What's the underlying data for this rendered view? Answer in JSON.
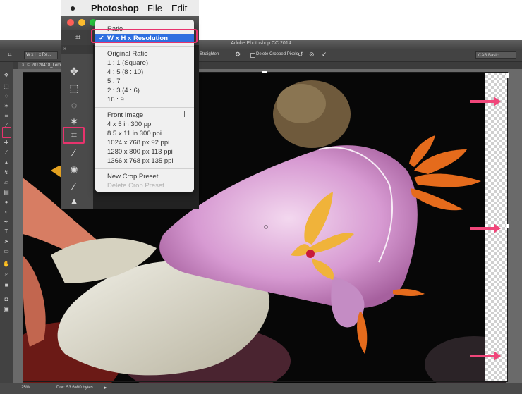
{
  "mac_menubar": {
    "apple_icon": "apple-logo",
    "app_name": "Photoshop",
    "menu_file": "File",
    "menu_edit": "Edit"
  },
  "window": {
    "title": "Adobe Photoshop CC 2014",
    "traffic_lights": [
      "#ff5f57",
      "#febc2e",
      "#28c840"
    ]
  },
  "options_bar": {
    "ratio_select": "W x H x Re...",
    "straighten_label": "Straighten",
    "delete_cropped_label": "Delete Cropped Pixels",
    "workspace_select": "CAB Basic"
  },
  "document_tab": {
    "label": "© 20120418_Lem"
  },
  "crop_ratio_menu": {
    "items": [
      {
        "label": "Ratio",
        "state": "normal"
      },
      {
        "label": "W x H x Resolution",
        "state": "selected"
      },
      {
        "label": "Original Ratio",
        "state": "normal"
      },
      {
        "label": "1 : 1 (Square)",
        "state": "normal"
      },
      {
        "label": "4 : 5 (8 : 10)",
        "state": "normal"
      },
      {
        "label": "5 : 7",
        "state": "normal"
      },
      {
        "label": "2 : 3 (4 : 6)",
        "state": "normal"
      },
      {
        "label": "16 : 9",
        "state": "normal"
      },
      {
        "label": "Front Image",
        "state": "normal"
      },
      {
        "label": "4 x 5 in 300 ppi",
        "state": "normal"
      },
      {
        "label": "8.5 x 11 in 300 ppi",
        "state": "normal"
      },
      {
        "label": "1024 x 768 px 92 ppi",
        "state": "normal"
      },
      {
        "label": "1280 x 800 px 113 ppi",
        "state": "normal"
      },
      {
        "label": "1366 x 768 px 135 ppi",
        "state": "normal"
      },
      {
        "label": "New Crop Preset...",
        "state": "normal"
      },
      {
        "label": "Delete Crop Preset...",
        "state": "disabled"
      }
    ]
  },
  "status_bar": {
    "zoom": "25%",
    "doc_info": "Doc: 53.6M/0 bytes"
  },
  "colors": {
    "highlight_pink": "#e8336d",
    "selection_blue": "#2f6fe0",
    "ui_dark": "#535353"
  }
}
